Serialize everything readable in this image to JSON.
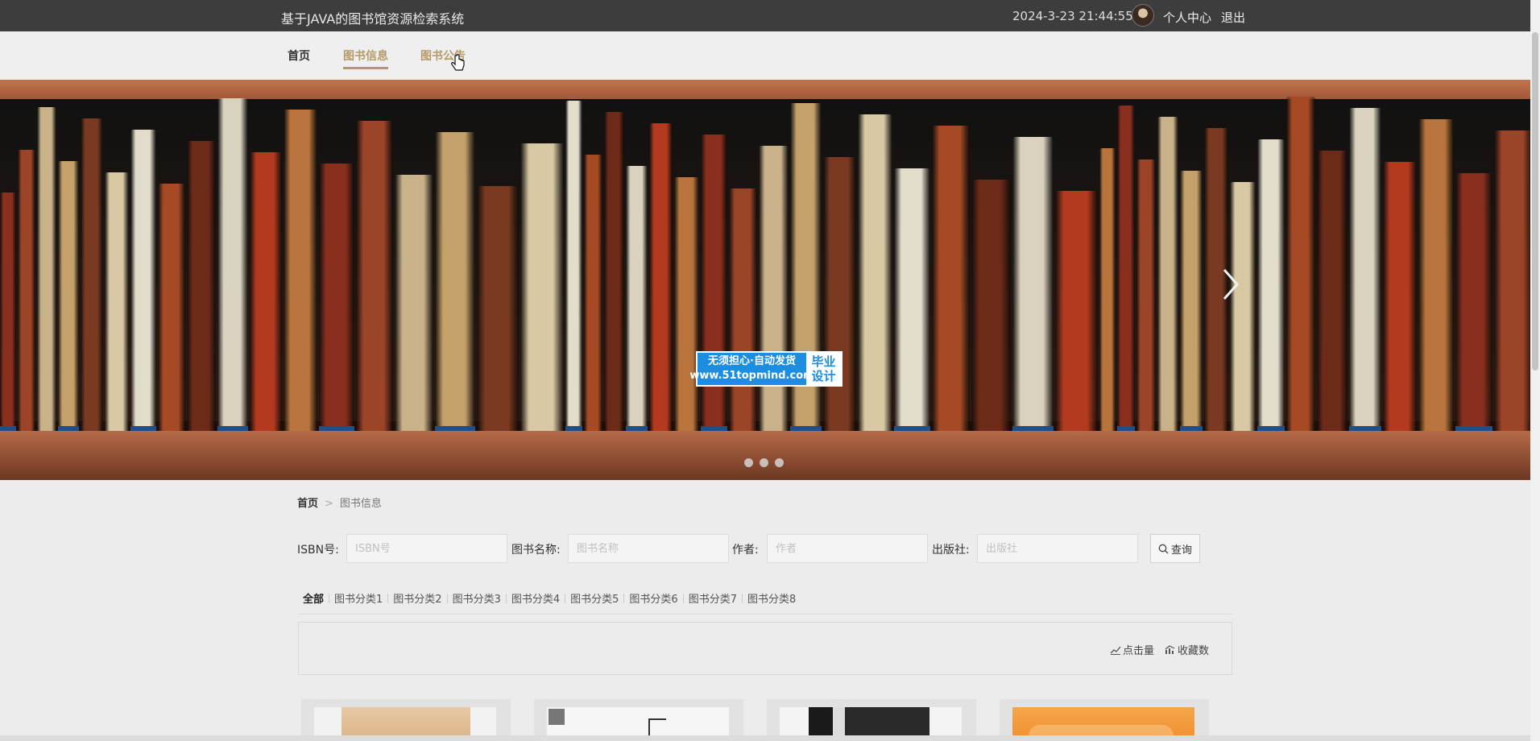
{
  "header": {
    "site_title": "基于JAVA的图书馆资源检索系统",
    "datetime": "2024-3-23 21:44:55",
    "profile_label": "个人中心",
    "logout_label": "退出"
  },
  "nav": {
    "home": "首页",
    "books": "图书信息",
    "notice": "图书公告",
    "active": "图书信息"
  },
  "banner": {
    "watermark_line1": "无须担心·自动发货",
    "watermark_line2": "www.51topmind.com",
    "watermark_right1": "毕业",
    "watermark_right2": "设计",
    "slide_count": 3
  },
  "breadcrumb": {
    "home": "首页",
    "separator": ">",
    "current": "图书信息"
  },
  "search": {
    "isbn_label": "ISBN号:",
    "isbn_placeholder": "ISBN号",
    "name_label": "图书名称:",
    "name_placeholder": "图书名称",
    "author_label": "作者:",
    "author_placeholder": "作者",
    "publisher_label": "出版社:",
    "publisher_placeholder": "出版社",
    "button_label": "查询"
  },
  "categories": [
    "全部",
    "图书分类1",
    "图书分类2",
    "图书分类3",
    "图书分类4",
    "图书分类5",
    "图书分类6",
    "图书分类7",
    "图书分类8"
  ],
  "sort": {
    "clicks_label": "点击量",
    "favorites_label": "收藏数"
  },
  "colors": {
    "accent": "#b49a6a",
    "topbar": "#3d3d3d",
    "watermark_blue": "#1d8de0"
  }
}
